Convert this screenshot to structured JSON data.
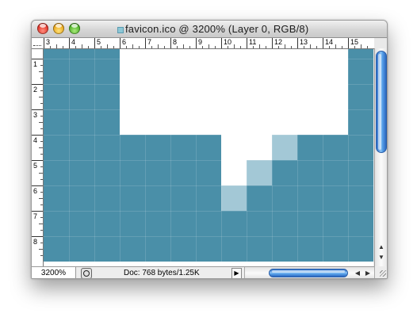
{
  "window": {
    "title": "favicon.ico @ 3200% (Layer 0, RGB/8)",
    "controls": [
      "close",
      "minimize",
      "zoom"
    ]
  },
  "ruler": {
    "horizontal_labels": [
      "3",
      "4",
      "5",
      "6",
      "7",
      "8",
      "9",
      "10",
      "11",
      "12",
      "13",
      "14",
      "15"
    ],
    "vertical_labels": [
      "1",
      "2",
      "3",
      "4",
      "5",
      "6",
      "7",
      "8"
    ]
  },
  "canvas": {
    "image": {
      "visible_columns": 13,
      "visible_rows": 9,
      "colors": {
        "blue": "#4a8fa8",
        "light": "#a3c8d6",
        "white": "#ffffff"
      },
      "pixels": [
        "BBBWWWWWWWWWB",
        "BBBWWWWWWWWWB",
        "BBBWWWWWWWWWB",
        "BBBWWWWWWWWWB",
        "BBBBBBBWWLBBB",
        "BBBBBBBWLBBBB",
        "BBBBBBBLBBBBB",
        "BBBBBBBBBBBBB",
        "BBBBBBBBBBBBB"
      ]
    }
  },
  "statusbar": {
    "zoom": "3200%",
    "doc_info": "Doc: 768 bytes/1.25K",
    "info_menu_icon": "triangle-right-icon"
  },
  "scrollbars": {
    "vertical_icon_up": "arrow-up-icon",
    "vertical_icon_down": "arrow-down-icon",
    "horizontal_icon_left": "arrow-left-icon",
    "horizontal_icon_right": "arrow-right-icon"
  }
}
